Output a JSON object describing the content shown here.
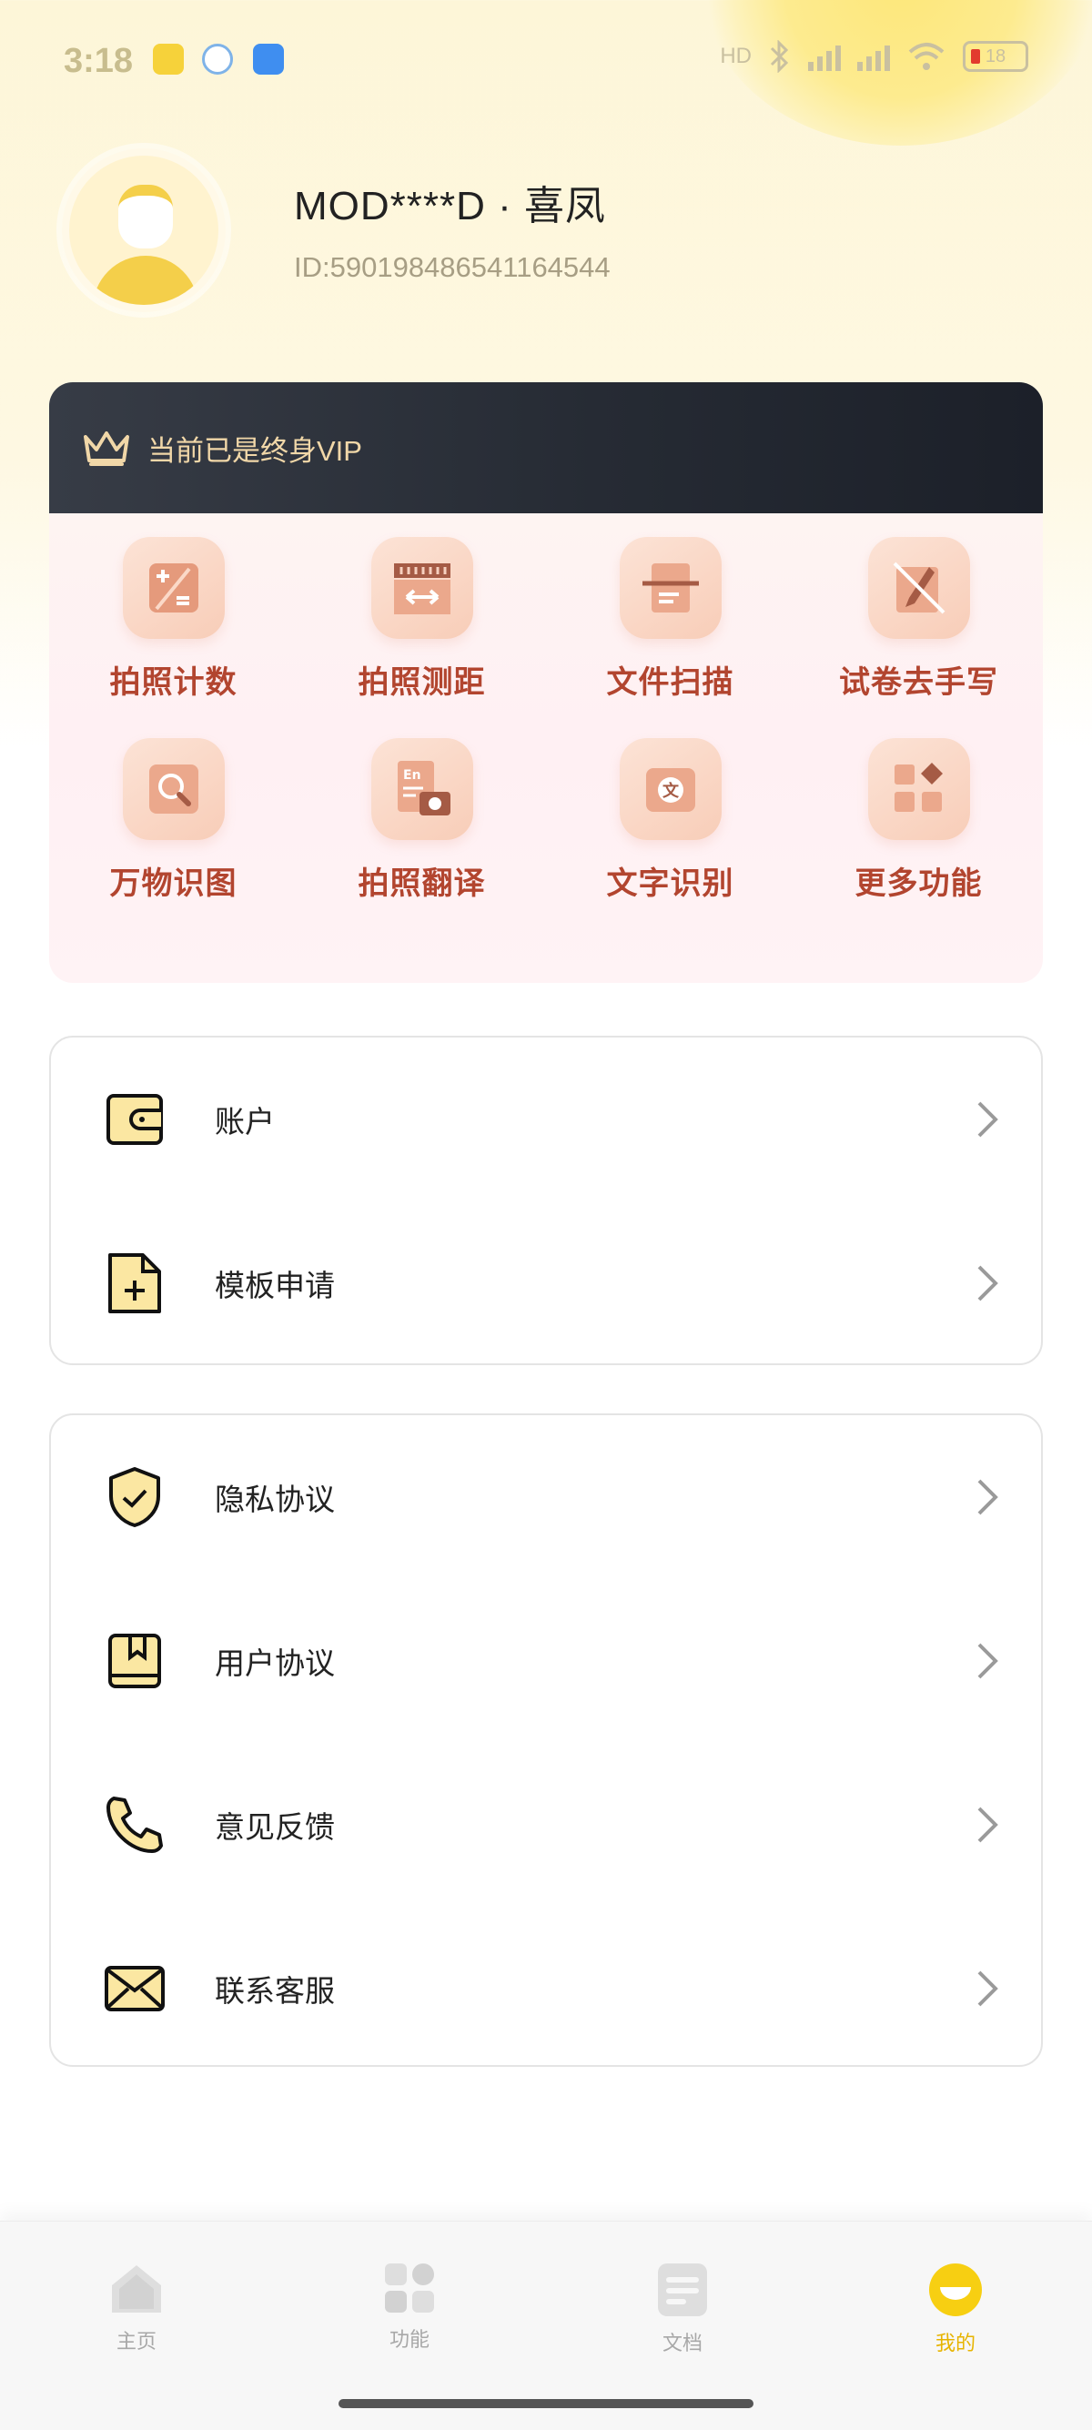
{
  "status_bar": {
    "time": "3:18",
    "battery": "18",
    "network": "HD"
  },
  "profile": {
    "name": "MOD****D · 喜凤",
    "id": "ID:590198486541164544"
  },
  "vip": {
    "status_text": "当前已是终身VIP",
    "features": [
      {
        "label": "拍照计数",
        "icon": "calculator-icon"
      },
      {
        "label": "拍照测距",
        "icon": "ruler-icon"
      },
      {
        "label": "文件扫描",
        "icon": "document-scan-icon"
      },
      {
        "label": "试卷去手写",
        "icon": "erase-handwriting-icon"
      },
      {
        "label": "万物识图",
        "icon": "image-search-icon"
      },
      {
        "label": "拍照翻译",
        "icon": "translate-camera-icon"
      },
      {
        "label": "文字识别",
        "icon": "text-recognition-icon"
      },
      {
        "label": "更多功能",
        "icon": "more-apps-icon"
      }
    ]
  },
  "menu_group1": [
    {
      "label": "账户",
      "icon": "wallet-icon"
    },
    {
      "label": "模板申请",
      "icon": "add-file-icon"
    }
  ],
  "menu_group2": [
    {
      "label": "隐私协议",
      "icon": "shield-check-icon"
    },
    {
      "label": "用户协议",
      "icon": "bookmark-book-icon"
    },
    {
      "label": "意见反馈",
      "icon": "phone-icon"
    },
    {
      "label": "联系客服",
      "icon": "mail-icon"
    }
  ],
  "tabbar": [
    {
      "label": "主页",
      "icon": "home-icon",
      "active": false
    },
    {
      "label": "功能",
      "icon": "grid-icon",
      "active": false
    },
    {
      "label": "文档",
      "icon": "document-icon",
      "active": false
    },
    {
      "label": "我的",
      "icon": "smile-icon",
      "active": true
    }
  ],
  "colors": {
    "accent": "#f4cf4a",
    "feature_label": "#b2452f",
    "vip_text": "#f1d7a8",
    "active_tab": "#e7b400"
  }
}
